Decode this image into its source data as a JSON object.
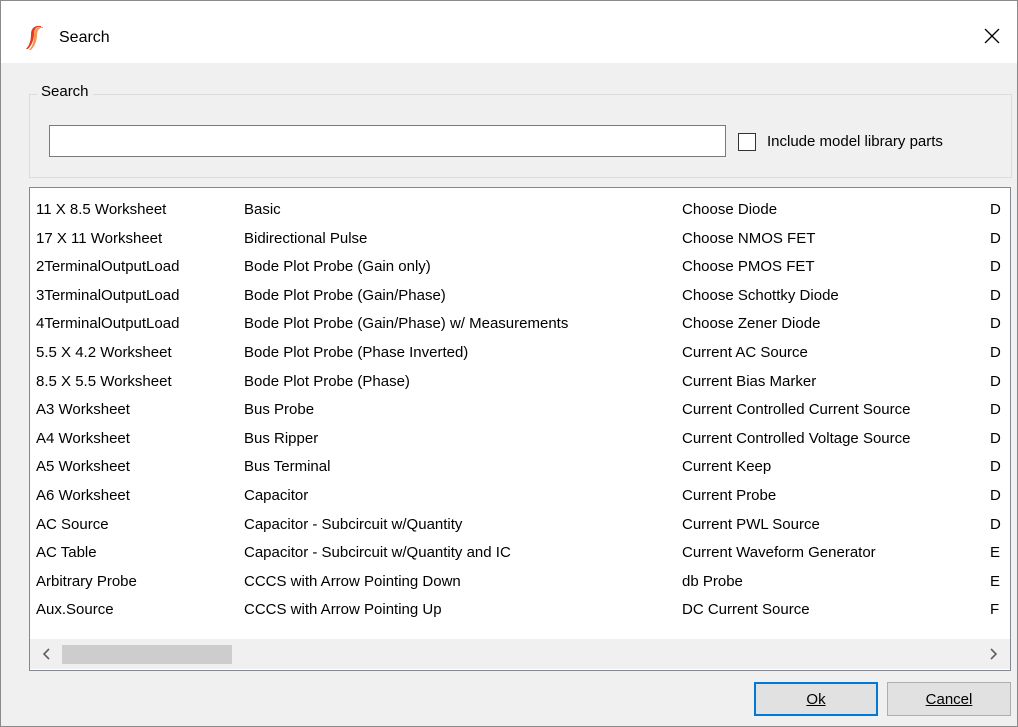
{
  "window": {
    "title": "Search"
  },
  "search": {
    "group_label": "Search",
    "input_value": "",
    "include_library_label": "Include model library parts",
    "include_library_checked": false
  },
  "results": {
    "columns": [
      {
        "items": [
          "11 X 8.5 Worksheet",
          "17 X 11 Worksheet",
          "2TerminalOutputLoad",
          "3TerminalOutputLoad",
          "4TerminalOutputLoad",
          "5.5 X 4.2 Worksheet",
          "8.5 X 5.5 Worksheet",
          "A3 Worksheet",
          "A4 Worksheet",
          "A5 Worksheet",
          "A6 Worksheet",
          "AC Source",
          "AC Table",
          "Arbitrary Probe",
          "Aux.Source"
        ]
      },
      {
        "items": [
          "Basic",
          "Bidirectional Pulse",
          "Bode Plot Probe (Gain only)",
          "Bode Plot Probe (Gain/Phase)",
          "Bode Plot Probe (Gain/Phase) w/ Measurements",
          "Bode Plot Probe (Phase Inverted)",
          "Bode Plot Probe (Phase)",
          "Bus Probe",
          "Bus Ripper",
          "Bus Terminal",
          "Capacitor",
          "Capacitor - Subcircuit w/Quantity",
          "Capacitor - Subcircuit w/Quantity and IC",
          "CCCS with Arrow Pointing Down",
          "CCCS with Arrow Pointing Up"
        ]
      },
      {
        "items": [
          "Choose Diode",
          "Choose NMOS FET",
          "Choose PMOS FET",
          "Choose Schottky Diode",
          "Choose Zener Diode",
          "Current AC Source",
          "Current Bias Marker",
          "Current Controlled Current Source",
          "Current Controlled Voltage Source",
          "Current Keep",
          "Current Probe",
          "Current PWL Source",
          "Current Waveform Generator",
          "db Probe",
          "DC Current Source"
        ]
      },
      {
        "items": [
          "D",
          "D",
          "D",
          "D",
          "D",
          "D",
          "D",
          "D",
          "D",
          "D",
          "D",
          "D",
          "E",
          "E",
          "F"
        ]
      }
    ]
  },
  "buttons": {
    "ok_label": "Ok",
    "cancel_label": "Cancel"
  },
  "colors": {
    "accent": "#0078d7",
    "app_icon": "#e8391b"
  }
}
